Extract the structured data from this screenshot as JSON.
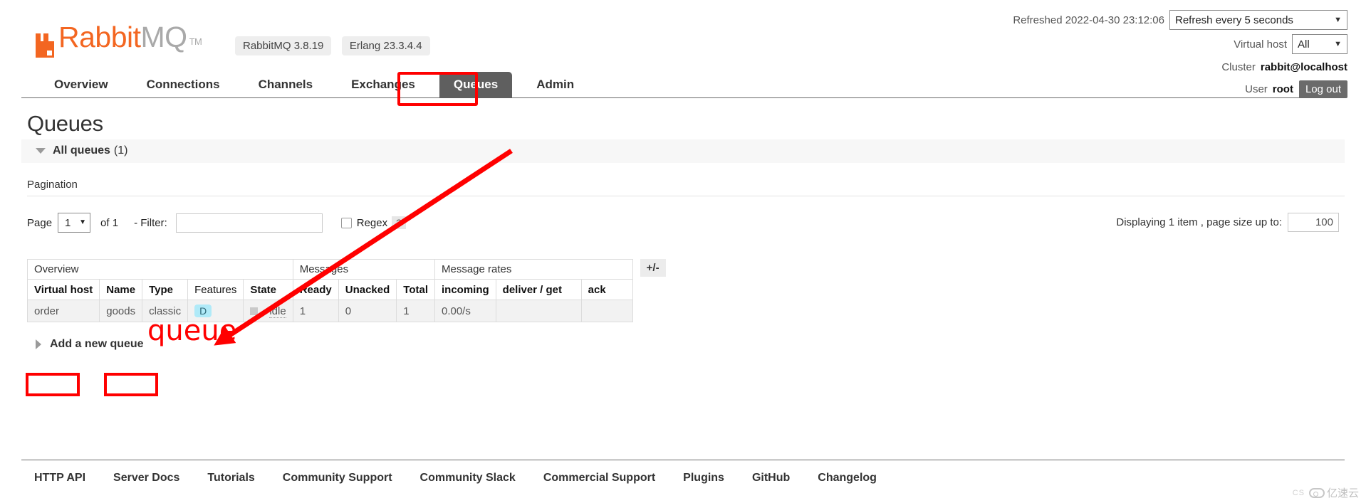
{
  "header": {
    "logo": {
      "rabbit": "Rabbit",
      "mq": "MQ",
      "tm": "TM"
    },
    "versions": [
      {
        "label": "RabbitMQ 3.8.19"
      },
      {
        "label": "Erlang 23.3.4.4"
      }
    ],
    "refreshed_label": "Refreshed 2022-04-30 23:12:06",
    "refresh_select": "Refresh every 5 seconds",
    "vhost_label": "Virtual host",
    "vhost_select": "All",
    "cluster_label": "Cluster",
    "cluster_value": "rabbit@localhost",
    "user_label": "User",
    "user_value": "root",
    "logout_label": "Log out"
  },
  "nav": {
    "tabs": [
      {
        "label": "Overview",
        "active": false
      },
      {
        "label": "Connections",
        "active": false
      },
      {
        "label": "Channels",
        "active": false
      },
      {
        "label": "Exchanges",
        "active": false
      },
      {
        "label": "Queues",
        "active": true
      },
      {
        "label": "Admin",
        "active": false
      }
    ]
  },
  "main": {
    "page_title": "Queues",
    "all_queues_label": "All queues",
    "all_queues_count": "(1)",
    "pagination_title": "Pagination",
    "page_label": "Page",
    "page_value": "1",
    "of_label": "of 1",
    "filter_label": "- Filter:",
    "filter_value": "",
    "filter_placeholder": "",
    "regex_label": "Regex",
    "help_label": "?",
    "displaying_label": "Displaying 1 item , page size up to:",
    "page_size_value": "100",
    "plus_minus_label": "+/-",
    "add_queue_label": "Add a new queue"
  },
  "table": {
    "group_headers": [
      {
        "label": "Overview",
        "colspan": 5
      },
      {
        "label": "Messages",
        "colspan": 3
      },
      {
        "label": "Message rates",
        "colspan": 3
      }
    ],
    "columns": [
      {
        "label": "Virtual host",
        "bold": true,
        "align": "left"
      },
      {
        "label": "Name",
        "bold": true,
        "align": "left"
      },
      {
        "label": "Type",
        "bold": true,
        "align": "left"
      },
      {
        "label": "Features",
        "bold": false,
        "align": "left"
      },
      {
        "label": "State",
        "bold": true,
        "align": "left"
      },
      {
        "label": "Ready",
        "bold": true,
        "align": "right"
      },
      {
        "label": "Unacked",
        "bold": true,
        "align": "right"
      },
      {
        "label": "Total",
        "bold": true,
        "align": "right"
      },
      {
        "label": "incoming",
        "bold": true,
        "align": "right"
      },
      {
        "label": "deliver / get",
        "bold": true,
        "align": "left"
      },
      {
        "label": "ack",
        "bold": true,
        "align": "left"
      }
    ],
    "rows": [
      {
        "vhost": "order",
        "name": "goods",
        "type": "classic",
        "features": "D",
        "state": "idle",
        "ready": "1",
        "unacked": "0",
        "total": "1",
        "incoming": "0.00/s",
        "deliver_get": "",
        "ack": ""
      }
    ]
  },
  "footer": {
    "links": [
      "HTTP API",
      "Server Docs",
      "Tutorials",
      "Community Support",
      "Community Slack",
      "Commercial Support",
      "Plugins",
      "GitHub",
      "Changelog"
    ],
    "watermark_cs": "CS",
    "watermark_text": "亿速云"
  },
  "annotations": {
    "queue_label": "queue",
    "color": "#ff0000"
  },
  "colors": {
    "brand_orange": "#f36621",
    "active_tab_bg": "#5f5f5f",
    "feature_badge_bg": "#b0eaf8",
    "annotation_red": "#ff0000"
  }
}
